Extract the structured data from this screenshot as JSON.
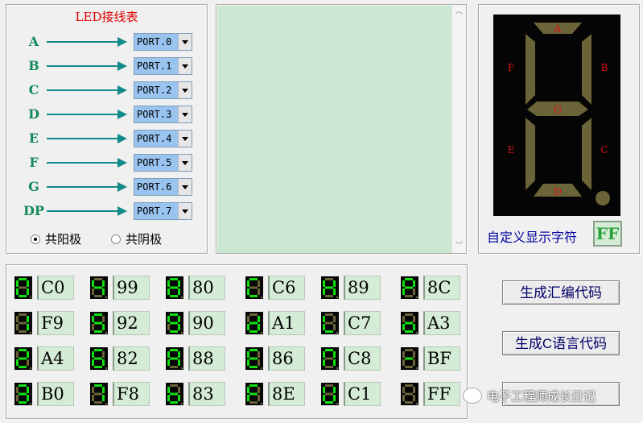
{
  "wiring": {
    "title": "LED接线表",
    "rows": [
      {
        "seg": "A",
        "port": "PORT.0"
      },
      {
        "seg": "B",
        "port": "PORT.1"
      },
      {
        "seg": "C",
        "port": "PORT.2"
      },
      {
        "seg": "D",
        "port": "PORT.3"
      },
      {
        "seg": "E",
        "port": "PORT.4"
      },
      {
        "seg": "F",
        "port": "PORT.5"
      },
      {
        "seg": "G",
        "port": "PORT.6"
      },
      {
        "seg": "DP",
        "port": "PORT.7"
      }
    ],
    "common_anode": "共阳极",
    "common_cathode": "共阴极",
    "selected_mode": "common_anode"
  },
  "segment_display": {
    "labels": {
      "a": "A",
      "b": "B",
      "c": "C",
      "d": "D",
      "e": "E",
      "f": "F",
      "g": "G"
    },
    "custom_label": "自定义显示字符",
    "custom_value": "FF"
  },
  "codes": {
    "rows": [
      [
        "C0",
        "99",
        "80",
        "C6",
        "89",
        "8C"
      ],
      [
        "F9",
        "92",
        "90",
        "A1",
        "C7",
        "A3"
      ],
      [
        "A4",
        "82",
        "88",
        "86",
        "C8",
        "BF"
      ],
      [
        "B0",
        "F8",
        "83",
        "8E",
        "C1",
        "FF"
      ]
    ]
  },
  "buttons": {
    "asm": "生成汇编代码",
    "c": "生成C语言代码"
  },
  "watermark": {
    "text": "电子工程师成长日记"
  },
  "colors": {
    "segment_on": "#10e010",
    "segment_off": "#6b6438",
    "segment_label": "#e01010",
    "preview_bg": "#cde8d2",
    "title_red": "#e00000",
    "arrow": "#138a8a"
  }
}
